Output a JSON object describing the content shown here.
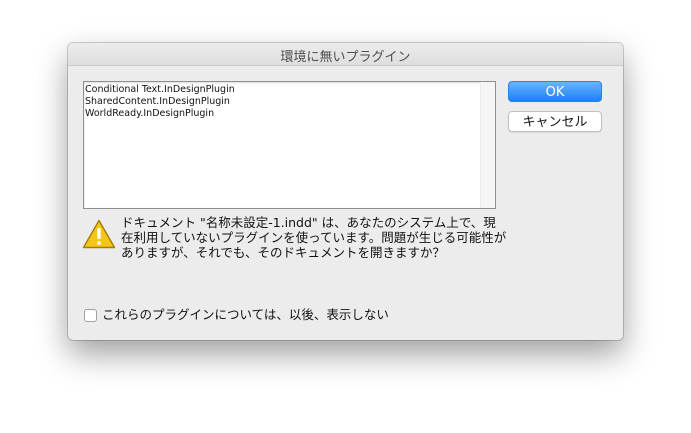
{
  "dialog": {
    "title": "環境に無いプラグイン",
    "plugins": [
      "Conditional Text.InDesignPlugin",
      "SharedContent.InDesignPlugin",
      "WorldReady.InDesignPlugin"
    ],
    "ok_label": "OK",
    "cancel_label": "キャンセル",
    "message_lines": [
      "ドキュメント \"名称未設定-1.indd\" は、あなたのシステム上で、現",
      "在利用していないプラグインを使っています。問題が生じる可能性が",
      "ありますが、それでも、そのドキュメントを開きますか？"
    ],
    "dont_show_label": "これらのプラグインについては、以後、表示しない",
    "dont_show_checked": false,
    "icon": "warning-icon",
    "colors": {
      "accent": "#1a82fb",
      "warning": "#f5c518"
    }
  }
}
